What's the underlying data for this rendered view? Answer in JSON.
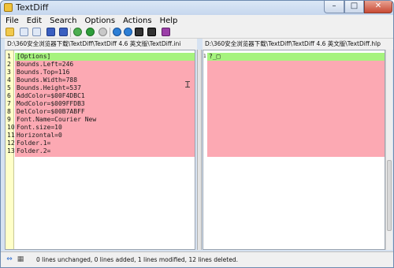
{
  "window": {
    "title": "TextDiff",
    "controls": {
      "minimize": "–",
      "maximize": "□",
      "close": "✕"
    }
  },
  "menu": [
    "File",
    "Edit",
    "Search",
    "Options",
    "Actions",
    "Help"
  ],
  "toolbar": {
    "icons": [
      "open-folder-icon",
      "copy-left-icon",
      "copy-right-icon",
      "save-left-icon",
      "save-right-icon",
      "refresh-icon",
      "go-icon",
      "stop-icon",
      "prev-diff-icon",
      "next-diff-icon",
      "find-icon",
      "find-next-icon",
      "help-book-icon"
    ]
  },
  "left": {
    "path": "D:\\360安全浏览器下载\\TextDiff\\TextDiff 4.6 英文版\\TextDiff.ini",
    "lines": [
      {
        "num": "1",
        "text": "[Options]",
        "state": "modified"
      },
      {
        "num": "2",
        "text": "Bounds.Left=246",
        "state": "deleted"
      },
      {
        "num": "3",
        "text": "Bounds.Top=116",
        "state": "deleted"
      },
      {
        "num": "4",
        "text": "Bounds.Width=788",
        "state": "deleted"
      },
      {
        "num": "5",
        "text": "Bounds.Height=537",
        "state": "deleted"
      },
      {
        "num": "6",
        "text": "AddColor=$00F4DBC1",
        "state": "deleted"
      },
      {
        "num": "7",
        "text": "ModColor=$009FFDB3",
        "state": "deleted"
      },
      {
        "num": "8",
        "text": "DelColor=$00B7ABFF",
        "state": "deleted"
      },
      {
        "num": "9",
        "text": "Font.Name=Courier New",
        "state": "deleted"
      },
      {
        "num": "10",
        "text": "Font.size=10",
        "state": "deleted"
      },
      {
        "num": "11",
        "text": "Horizontal=0",
        "state": "deleted"
      },
      {
        "num": "12",
        "text": "Folder.1=",
        "state": "deleted"
      },
      {
        "num": "13",
        "text": "Folder.2=",
        "state": "deleted"
      }
    ]
  },
  "right": {
    "path": "D:\\360安全浏览器下载\\TextDiff\\TextDiff 4.6 英文版\\TextDiff.hlp",
    "lines": [
      {
        "num": "1",
        "text": "?_□",
        "state": "modified"
      }
    ]
  },
  "status": {
    "text": "0 lines unchanged, 0 lines added, 1 lines modified, 12 lines deleted."
  },
  "colors": {
    "modified": "#a6f37e",
    "deleted": "#fca9b3",
    "gutter": "#ffffc8"
  }
}
